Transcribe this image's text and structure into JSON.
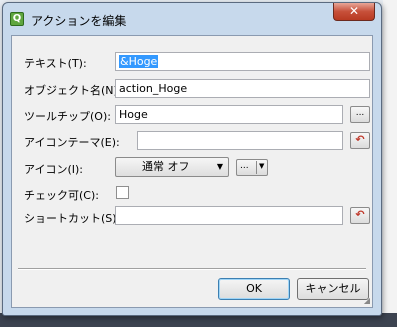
{
  "window": {
    "title": "アクションを編集",
    "app_icon": "Q",
    "close_glyph": "✕"
  },
  "form": {
    "text": {
      "label": "テキスト(T):",
      "value": "&Hoge",
      "selected": true
    },
    "object_name": {
      "label": "オブジェクト名(N):",
      "value": "action_Hoge"
    },
    "tooltip": {
      "label": "ツールチップ(O):",
      "value": "Hoge",
      "browse_label": "..."
    },
    "icon_theme": {
      "label": "アイコンテーマ(E):",
      "value": "",
      "reset_icon": "reset-arrow-icon"
    },
    "icon": {
      "label": "アイコン(I):",
      "mode_value": "通常 オフ",
      "mode_arrow": "▼",
      "browse_label": "...",
      "browse_arrow": "▼"
    },
    "checkable": {
      "label": "チェック可(C):",
      "checked": false
    },
    "shortcut": {
      "label": "ショートカット(S):",
      "value": "",
      "reset_icon": "reset-arrow-icon"
    }
  },
  "buttons": {
    "ok": "OK",
    "cancel": "キャンセル"
  },
  "reset_glyph": "↶"
}
